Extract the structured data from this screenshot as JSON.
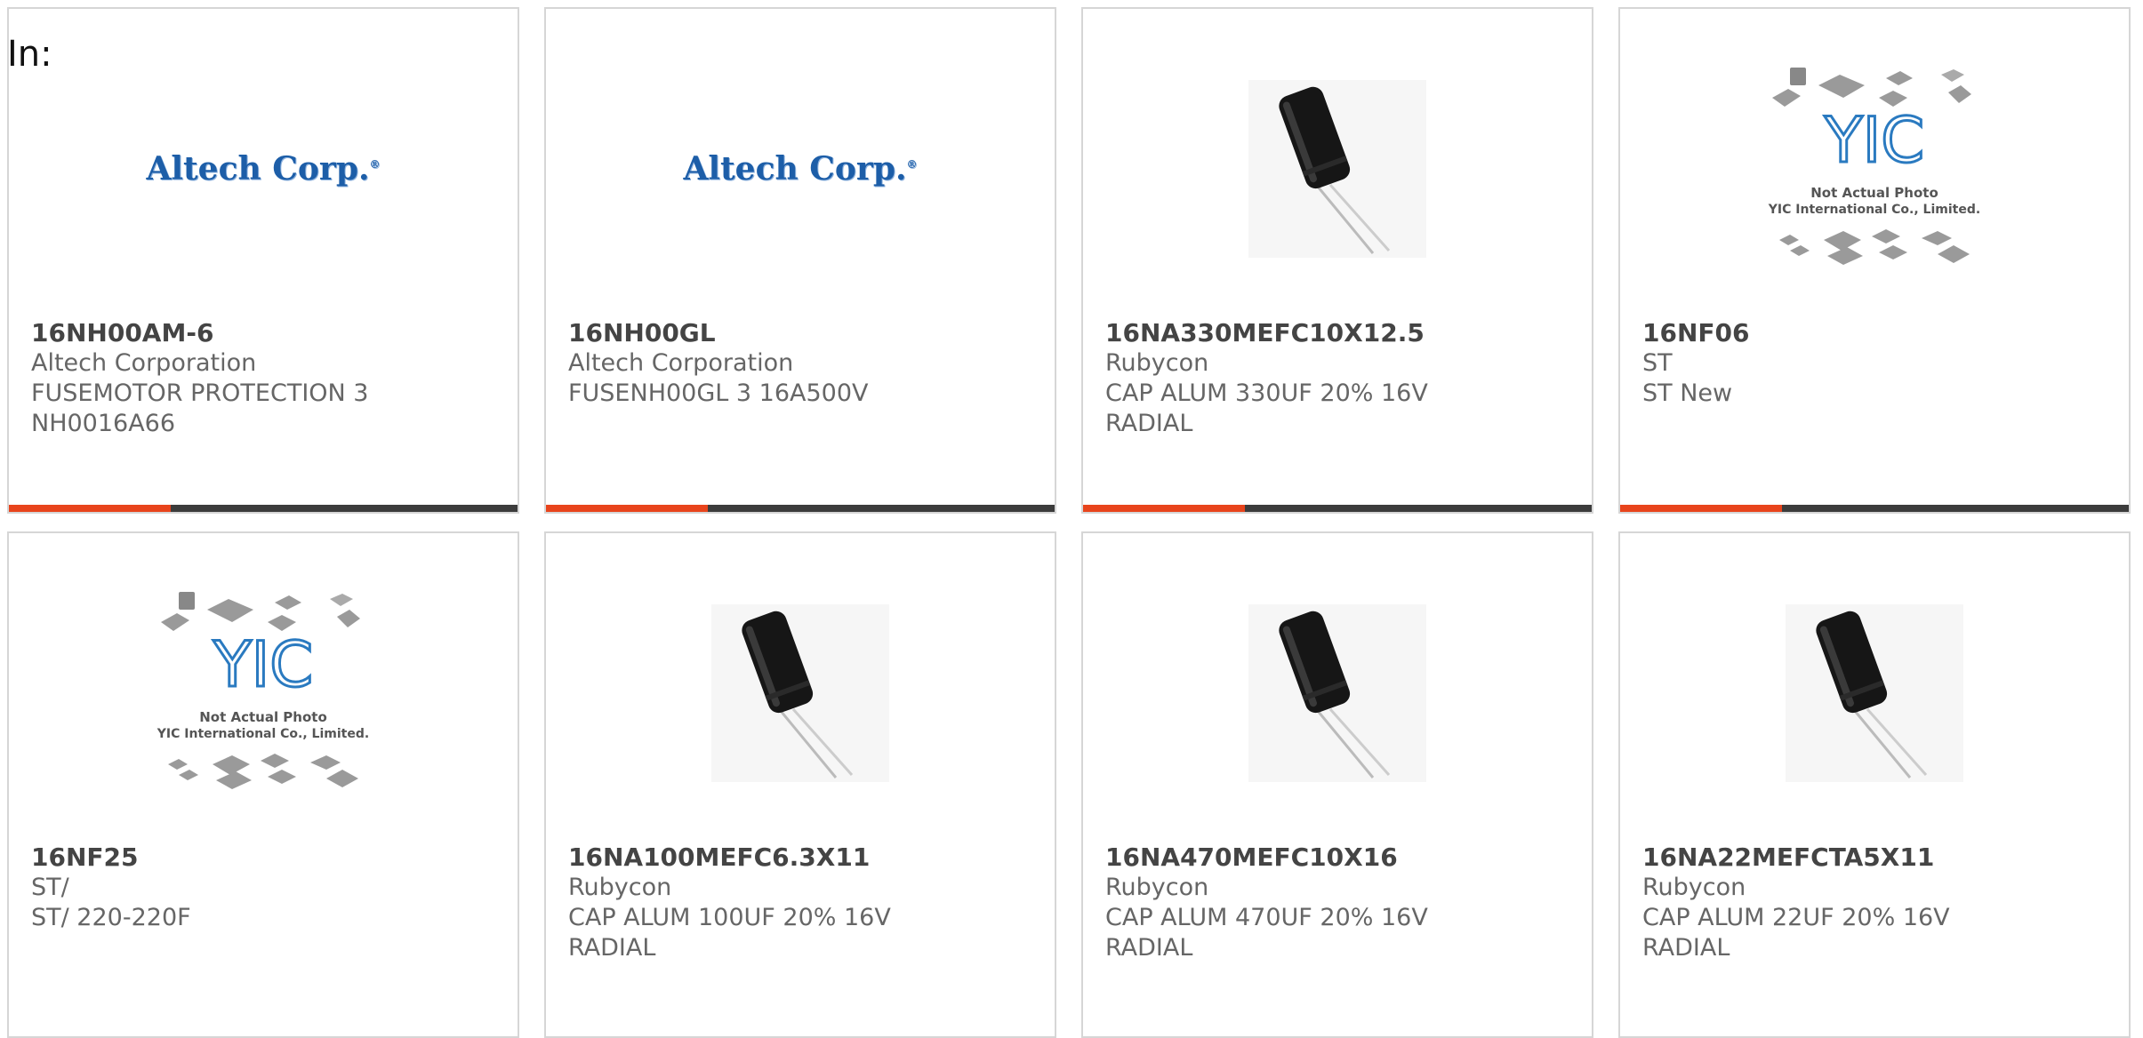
{
  "header": {
    "label": "In:"
  },
  "colors": {
    "accent": "#e8441c",
    "bar": "#3c3c3c",
    "logo_blue": "#1d5ea8",
    "yic_blue": "#2a7ac0"
  },
  "products": [
    {
      "image": "altech-logo",
      "image_text": "Altech Corp.",
      "part": "16NH00AM-6",
      "maker": "Altech Corporation",
      "desc1": "FUSEMOTOR PROTECTION 3",
      "desc2": "NH0016A66"
    },
    {
      "image": "altech-logo",
      "image_text": "Altech Corp.",
      "part": "16NH00GL",
      "maker": "Altech Corporation",
      "desc1": "FUSENH00GL 3 16A500V",
      "desc2": ""
    },
    {
      "image": "capacitor-photo",
      "part": "16NA330MEFC10X12.5",
      "maker": "Rubycon",
      "desc1": "CAP ALUM 330UF 20% 16V",
      "desc2": "RADIAL"
    },
    {
      "image": "yic-placeholder",
      "image_text1": "Not Actual Photo",
      "image_text2": "YIC International Co., Limited.",
      "part": "16NF06",
      "maker": "ST",
      "desc1": "ST New",
      "desc2": ""
    },
    {
      "image": "yic-placeholder",
      "image_text1": "Not Actual Photo",
      "image_text2": "YIC International Co., Limited.",
      "part": "16NF25",
      "maker": "ST/",
      "desc1": "ST/ 220-220F",
      "desc2": ""
    },
    {
      "image": "capacitor-photo",
      "part": "16NA100MEFC6.3X11",
      "maker": "Rubycon",
      "desc1": "CAP ALUM 100UF 20% 16V",
      "desc2": "RADIAL"
    },
    {
      "image": "capacitor-photo",
      "part": "16NA470MEFC10X16",
      "maker": "Rubycon",
      "desc1": "CAP ALUM 470UF 20% 16V",
      "desc2": "RADIAL"
    },
    {
      "image": "capacitor-photo",
      "part": "16NA22MEFCTA5X11",
      "maker": "Rubycon",
      "desc1": "CAP ALUM 22UF 20% 16V",
      "desc2": "RADIAL"
    }
  ]
}
